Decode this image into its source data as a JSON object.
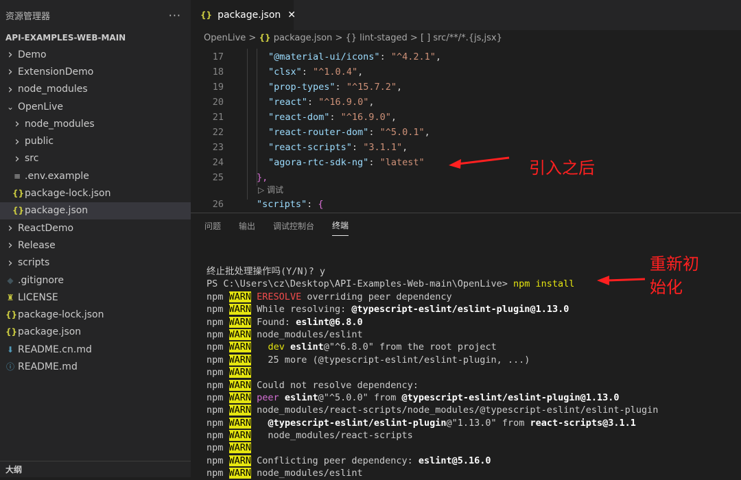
{
  "sidebar": {
    "title": "资源管理器",
    "more": "···",
    "root": "API-EXAMPLES-WEB-MAIN",
    "outline": "大纲",
    "items": [
      {
        "label": "Demo",
        "indent": 0,
        "icon": "chevron-right-icon"
      },
      {
        "label": "ExtensionDemo",
        "indent": 0,
        "icon": "chevron-right-icon"
      },
      {
        "label": "node_modules",
        "indent": 0,
        "icon": "chevron-right-icon"
      },
      {
        "label": "OpenLive",
        "indent": 0,
        "icon": "chevron-down-icon"
      },
      {
        "label": "node_modules",
        "indent": 1,
        "icon": "chevron-right-icon"
      },
      {
        "label": "public",
        "indent": 1,
        "icon": "chevron-right-icon"
      },
      {
        "label": "src",
        "indent": 1,
        "icon": "chevron-right-icon"
      },
      {
        "label": ".env.example",
        "indent": 1,
        "icon": "env-file-icon"
      },
      {
        "label": "package-lock.json",
        "indent": 1,
        "icon": "json-icon"
      },
      {
        "label": "package.json",
        "indent": 1,
        "icon": "json-icon",
        "selected": true
      },
      {
        "label": "ReactDemo",
        "indent": 0,
        "icon": "chevron-right-icon"
      },
      {
        "label": "Release",
        "indent": 0,
        "icon": "chevron-right-icon"
      },
      {
        "label": "scripts",
        "indent": 0,
        "icon": "chevron-right-icon"
      },
      {
        "label": ".gitignore",
        "indent": 0,
        "icon": "git-icon"
      },
      {
        "label": "LICENSE",
        "indent": 0,
        "icon": "license-icon"
      },
      {
        "label": "package-lock.json",
        "indent": 0,
        "icon": "json-icon"
      },
      {
        "label": "package.json",
        "indent": 0,
        "icon": "json-icon"
      },
      {
        "label": "README.cn.md",
        "indent": 0,
        "icon": "markdown-icon"
      },
      {
        "label": "README.md",
        "indent": 0,
        "icon": "info-icon"
      }
    ]
  },
  "tab": {
    "icon": "{}",
    "label": "package.json",
    "close": "✕"
  },
  "breadcrumb": {
    "p1": "OpenLive",
    "sep": ">",
    "j1": "{}",
    "p2": "package.json",
    "p3": "{} lint-staged",
    "p4": "[ ] src/**/*.{js,jsx}"
  },
  "code": {
    "lines": [
      {
        "n": "17",
        "key": "\"@material-ui/icons\"",
        "val": "\"^4.2.1\""
      },
      {
        "n": "18",
        "key": "\"clsx\"",
        "val": "\"^1.0.4\""
      },
      {
        "n": "19",
        "key": "\"prop-types\"",
        "val": "\"^15.7.2\""
      },
      {
        "n": "20",
        "key": "\"react\"",
        "val": "\"^16.9.0\""
      },
      {
        "n": "21",
        "key": "\"react-dom\"",
        "val": "\"^16.9.0\""
      },
      {
        "n": "22",
        "key": "\"react-router-dom\"",
        "val": "\"^5.0.1\""
      },
      {
        "n": "23",
        "key": "\"react-scripts\"",
        "val": "\"3.1.1\""
      },
      {
        "n": "24",
        "key": "\"agora-rtc-sdk-ng\"",
        "val": "\"latest\"",
        "last": true
      }
    ],
    "line25": {
      "n": "25",
      "text": "},"
    },
    "codelens": "▷ 调试",
    "line26": {
      "n": "26",
      "key": "\"scripts\"",
      "brace": "{"
    }
  },
  "panel_tabs": [
    {
      "label": "问题",
      "active": false
    },
    {
      "label": "输出",
      "active": false
    },
    {
      "label": "调试控制台",
      "active": false
    },
    {
      "label": "终端",
      "active": true
    }
  ],
  "terminal": {
    "prompt_q": "终止批处理操作吗(Y/N)? y",
    "ps": "PS C:\\Users\\cz\\Desktop\\API-Examples-Web-main\\OpenLive> ",
    "cmd": "npm install",
    "npm": "npm",
    "warn": "WARN",
    "lines": [
      [
        {
          "t": "ERESOLVE",
          "c": "red"
        },
        {
          "t": " overriding peer dependency"
        }
      ],
      [
        {
          "t": "While resolving: "
        },
        {
          "t": "@typescript-eslint/eslint-plugin",
          "c": "bold"
        },
        {
          "t": "@1.13.0",
          "c": "bold"
        }
      ],
      [
        {
          "t": "Found: "
        },
        {
          "t": "eslint",
          "c": "bold"
        },
        {
          "t": "@6.8.0",
          "c": "bold"
        }
      ],
      [
        {
          "t": "node_modules/eslint"
        }
      ],
      [
        {
          "t": "  "
        },
        {
          "t": "dev",
          "c": "yl"
        },
        {
          "t": " "
        },
        {
          "t": "eslint",
          "c": "bold"
        },
        {
          "t": "@\"^6.8.0\" from the root project"
        }
      ],
      [
        {
          "t": "  25 more (@typescript-eslint/eslint-plugin, ...)"
        }
      ],
      [],
      [
        {
          "t": "Could not resolve dependency:"
        }
      ],
      [
        {
          "t": "peer",
          "c": "mag"
        },
        {
          "t": " "
        },
        {
          "t": "eslint",
          "c": "bold"
        },
        {
          "t": "@\"^5.0.0\" from "
        },
        {
          "t": "@typescript-eslint/eslint-plugin",
          "c": "bold"
        },
        {
          "t": "@1.13.0",
          "c": "bold"
        }
      ],
      [
        {
          "t": "node_modules/react-scripts/node_modules/@typescript-eslint/eslint-plugin"
        }
      ],
      [
        {
          "t": "  "
        },
        {
          "t": "@typescript-eslint/eslint-plugin",
          "c": "bold"
        },
        {
          "t": "@\"1.13.0\" from "
        },
        {
          "t": "react-scripts",
          "c": "bold"
        },
        {
          "t": "@3.1.1",
          "c": "bold"
        }
      ],
      [
        {
          "t": "  node_modules/react-scripts"
        }
      ],
      [],
      [
        {
          "t": "Conflicting peer dependency: "
        },
        {
          "t": "eslint",
          "c": "bold"
        },
        {
          "t": "@5.16.0",
          "c": "bold"
        }
      ],
      [
        {
          "t": "node_modules/eslint"
        }
      ]
    ]
  },
  "annotations": {
    "after_import": "引入之后",
    "reinit_line1": "重新初",
    "reinit_line2": "始化",
    "color": "#ff2020"
  }
}
